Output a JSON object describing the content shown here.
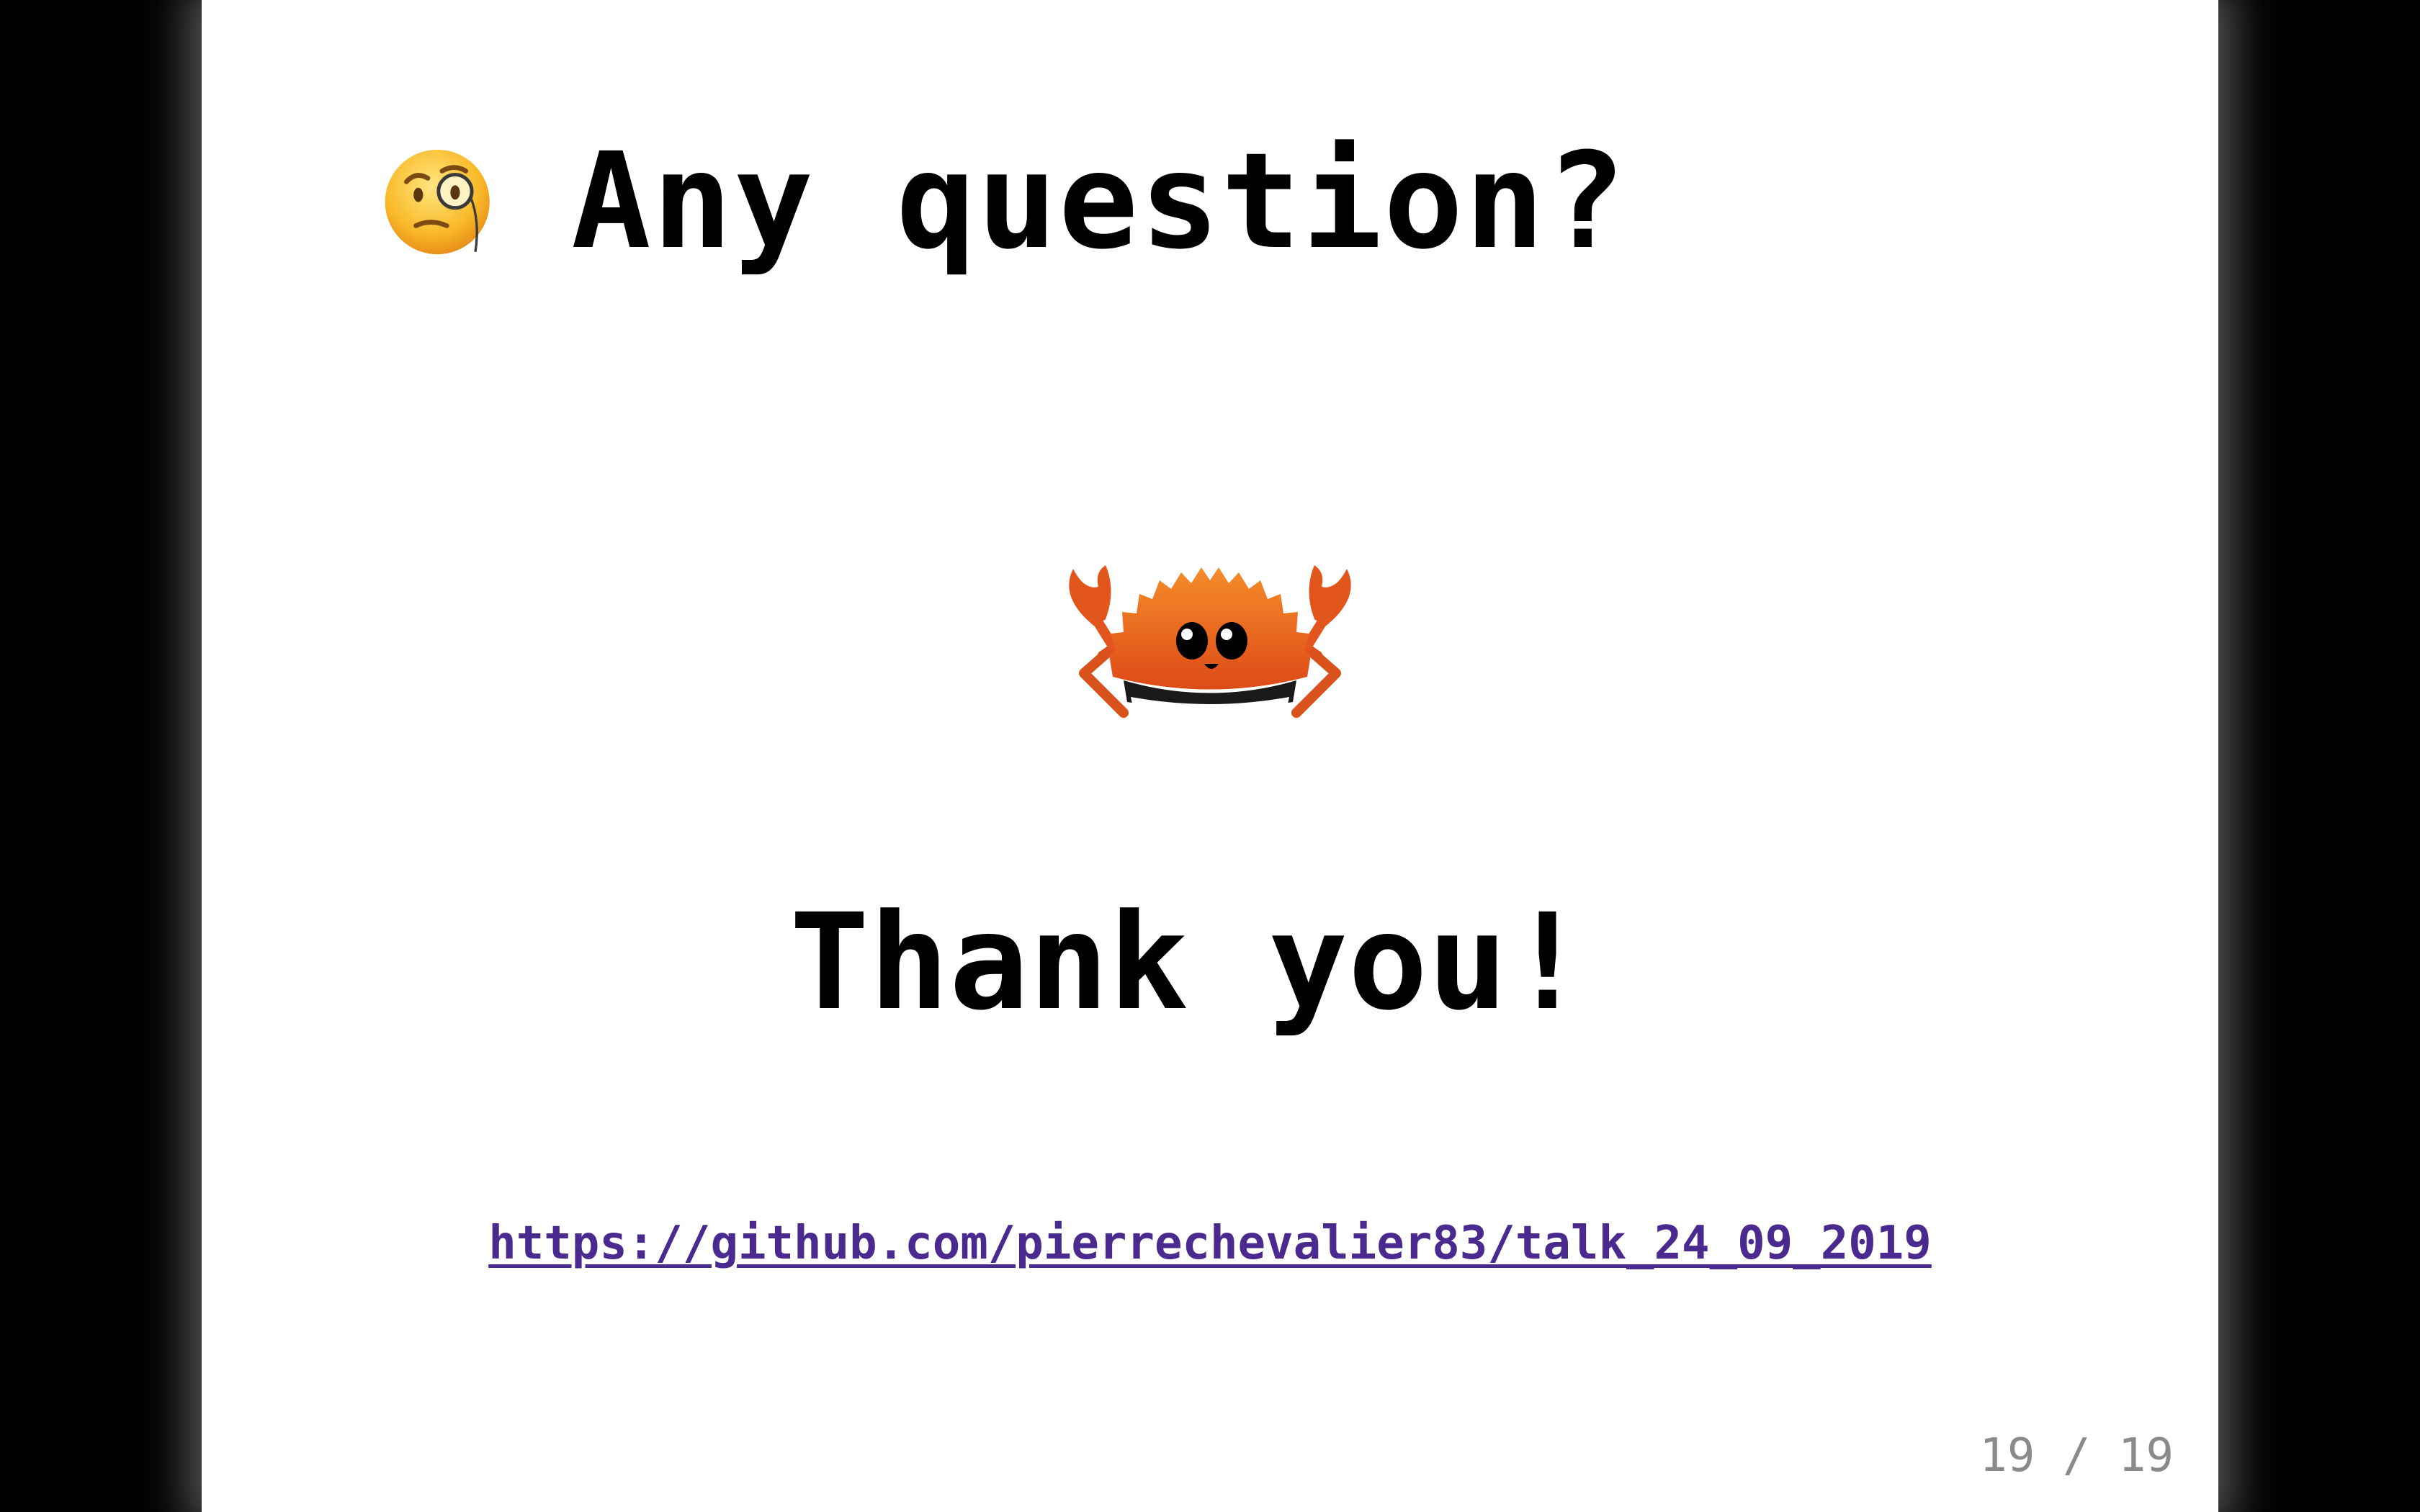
{
  "slide": {
    "heading": "Any question?",
    "heading_icon": "monocle-face-emoji",
    "mascot": "ferris-crab",
    "thanks": "Thank you!",
    "link": "https://github.com/pierrechevalier83/talk_24_09_2019",
    "counter": "19 / 19"
  },
  "colors": {
    "background": "#000000",
    "slide": "#ffffff",
    "text": "#000000",
    "link": "#4b2a8f",
    "counter": "#8a8a8a",
    "crab": "#e2561d"
  }
}
